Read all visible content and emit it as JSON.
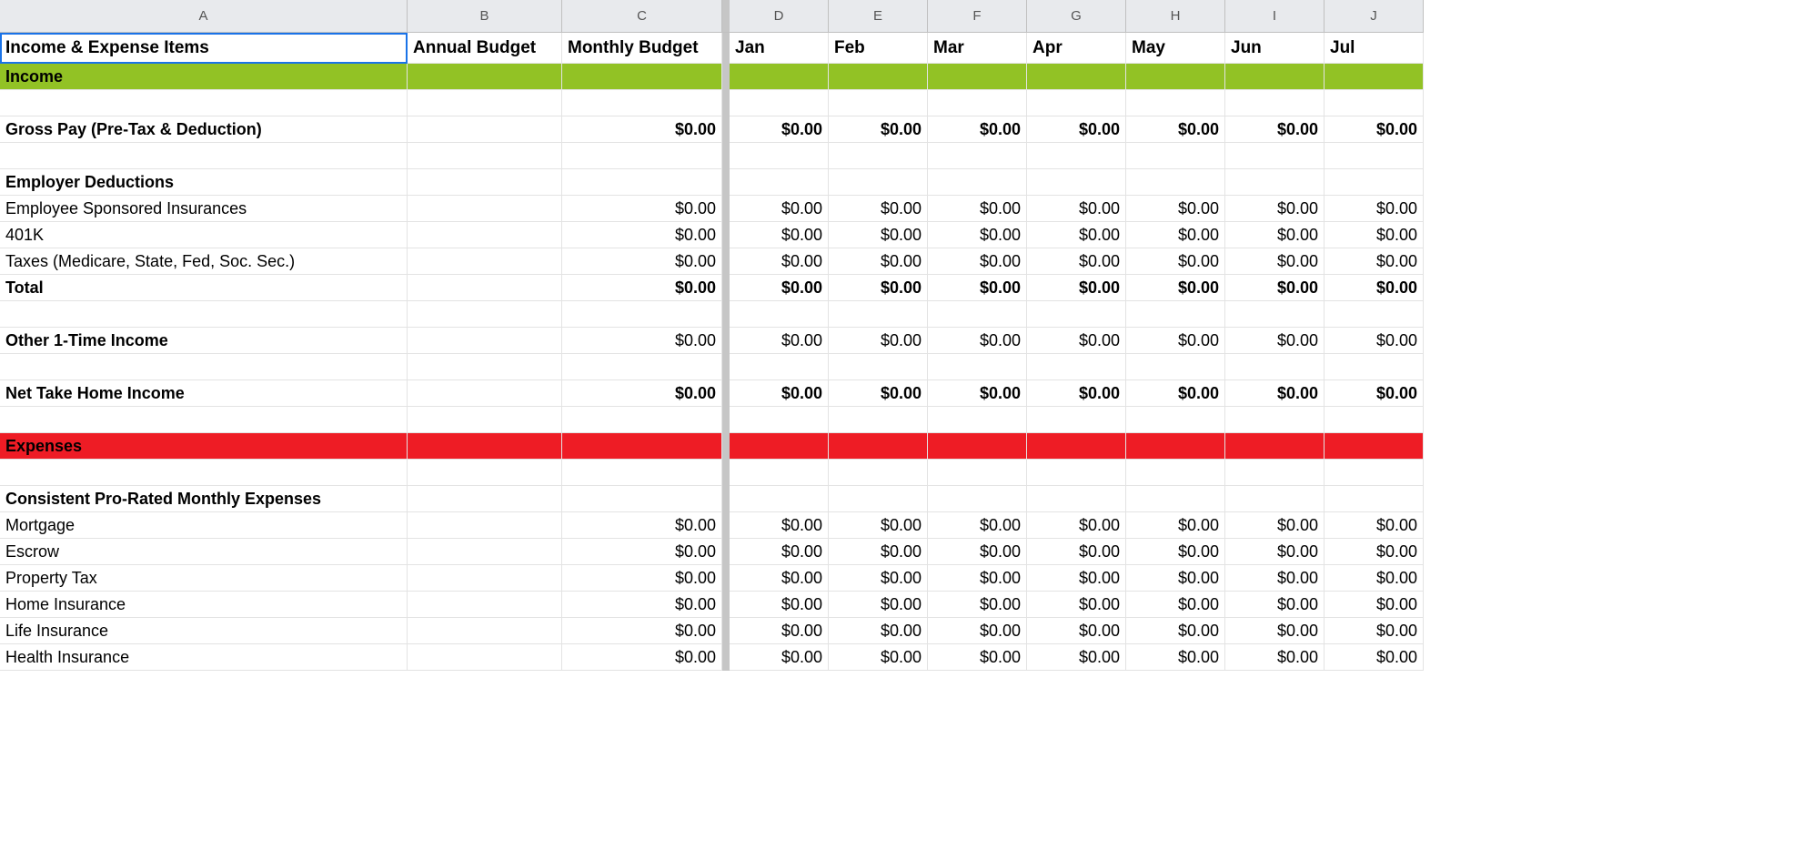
{
  "columns": [
    "A",
    "B",
    "C",
    "",
    "D",
    "E",
    "F",
    "G",
    "H",
    "I",
    "J"
  ],
  "header_row": {
    "A": "Income & Expense Items",
    "B": "Annual Budget",
    "C": "Monthly Budget",
    "D": "Jan",
    "E": "Feb",
    "F": "Mar",
    "G": "Apr",
    "H": "May",
    "I": "Jun",
    "J": "Jul"
  },
  "rows": [
    {
      "kind": "section",
      "class": "bg-income",
      "A": "Income"
    },
    {
      "kind": "blank"
    },
    {
      "kind": "bold-money",
      "A": "Gross Pay (Pre-Tax & Deduction)",
      "C": "$0.00",
      "months": "$0.00"
    },
    {
      "kind": "blank"
    },
    {
      "kind": "bold",
      "A": "Employer Deductions"
    },
    {
      "kind": "money",
      "A": "Employee Sponsored Insurances",
      "C": "$0.00",
      "months": "$0.00"
    },
    {
      "kind": "money",
      "A": "401K",
      "C": "$0.00",
      "months": "$0.00"
    },
    {
      "kind": "money",
      "A": "Taxes (Medicare, State, Fed, Soc. Sec.)",
      "C": "$0.00",
      "months": "$0.00"
    },
    {
      "kind": "bold-money",
      "A": "Total",
      "C": "$0.00",
      "months": "$0.00"
    },
    {
      "kind": "blank"
    },
    {
      "kind": "bold-money-mixed",
      "A": "Other 1-Time Income",
      "C": "$0.00",
      "months": "$0.00"
    },
    {
      "kind": "blank"
    },
    {
      "kind": "bold-money",
      "A": "Net Take Home Income",
      "C": "$0.00",
      "months": "$0.00"
    },
    {
      "kind": "blank"
    },
    {
      "kind": "section",
      "class": "bg-expense",
      "A": "Expenses"
    },
    {
      "kind": "blank"
    },
    {
      "kind": "bold",
      "A": "Consistent Pro-Rated Monthly Expenses"
    },
    {
      "kind": "money",
      "A": "Mortgage",
      "C": "$0.00",
      "months": "$0.00"
    },
    {
      "kind": "money",
      "A": "Escrow",
      "C": "$0.00",
      "months": "$0.00"
    },
    {
      "kind": "money",
      "A": "Property Tax",
      "C": "$0.00",
      "months": "$0.00"
    },
    {
      "kind": "money",
      "A": "Home Insurance",
      "C": "$0.00",
      "months": "$0.00"
    },
    {
      "kind": "money",
      "A": "Life Insurance",
      "C": "$0.00",
      "months": "$0.00"
    },
    {
      "kind": "money",
      "A": "Health Insurance",
      "C": "$0.00",
      "months": "$0.00"
    }
  ]
}
